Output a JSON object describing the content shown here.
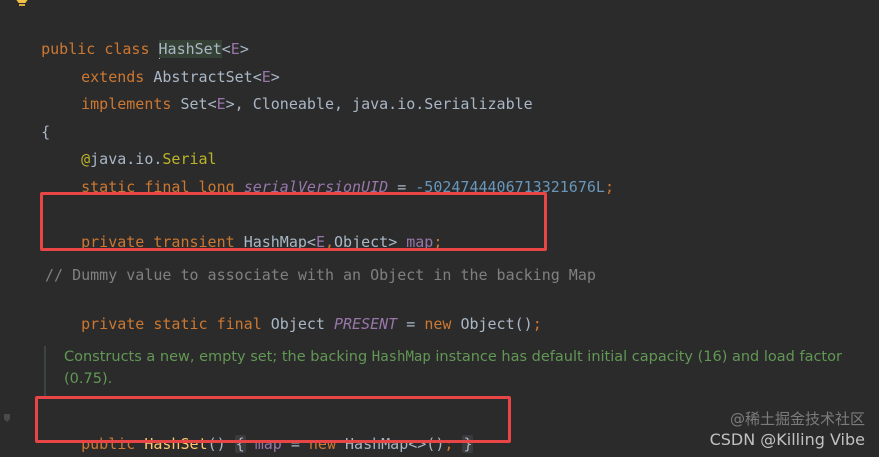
{
  "code": {
    "l1": {
      "kw": "public class ",
      "cls": "HashSet",
      "tp_open": "<",
      "tp": "E",
      "tp_close": ">"
    },
    "l2": {
      "kw": "extends ",
      "cls": "AbstractSet",
      "tp_open": "<",
      "tp": "E",
      "tp_close": ">"
    },
    "l3": {
      "kw": "implements ",
      "t1": "Set",
      "tp_open": "<",
      "tp": "E",
      "tp_close": ">",
      "rest": ", Cloneable, java.io.Serializable"
    },
    "l4": {
      "text": "{"
    },
    "l5": {
      "at": "@",
      "pkg": "java.io.",
      "anno": "Serial"
    },
    "l6": {
      "kw": "static final long ",
      "field": "serialVersionUID",
      "eq": " = ",
      "num": "-5024744406713321676L",
      "semi": ";"
    },
    "l7": {
      "kw": "private transient ",
      "type": "HashMap",
      "tp_open": "<",
      "tp": "E",
      "comma": ",",
      "obj": "Object",
      "tp_close": "> ",
      "field": "map",
      "semi": ";"
    },
    "l8": {
      "text": "// Dummy value to associate with an Object in the backing Map"
    },
    "l9": {
      "kw": "private static final ",
      "type": "Object ",
      "field": "PRESENT",
      "eq": " = ",
      "new_kw": "new ",
      "ctor": "Object()",
      "semi": ";"
    },
    "doc": {
      "part1": "Constructs a new, empty set; the backing ",
      "mono": "HashMap",
      "part2": " instance has default initial capacity (16) and load factor (0.75)."
    },
    "l10": {
      "kw": "public ",
      "fn": "HashSet",
      "parens": "()",
      "brace_open": "{",
      "field": "map",
      "eq": " = ",
      "new_kw": "new ",
      "ctor": "HashMap<>()",
      "semi": ";",
      "brace_close": "}"
    }
  },
  "watermark": {
    "line1": "@稀土掘金技术社区",
    "line2": "CSDN @Killing Vibe"
  },
  "colors": {
    "background": "#2b2b2b",
    "keyword": "#cc7832",
    "type_param": "#9876aa",
    "number": "#6897bb",
    "comment": "#808080",
    "annotation": "#bbb529",
    "doc_comment": "#629755",
    "function": "#ffc66d",
    "highlight_box": "#e84646"
  },
  "icons": {
    "bulb": "lightbulb-icon"
  }
}
